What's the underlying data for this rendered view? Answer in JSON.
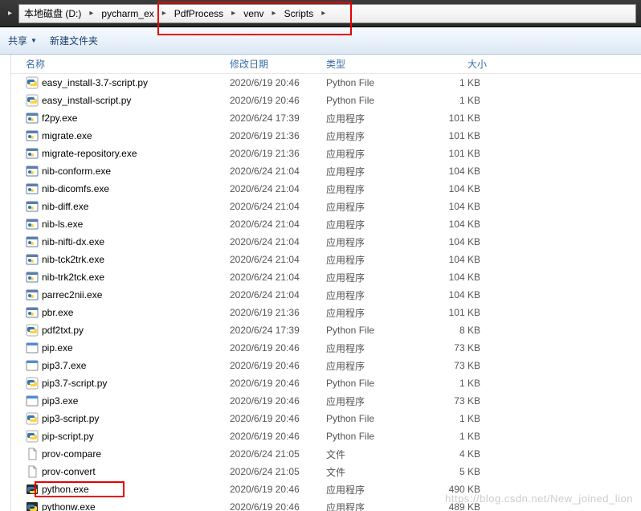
{
  "breadcrumb": {
    "items": [
      {
        "label": "本地磁盘 (D:)"
      },
      {
        "label": "pycharm_ex"
      },
      {
        "label": "PdfProcess"
      },
      {
        "label": "venv"
      },
      {
        "label": "Scripts"
      }
    ]
  },
  "toolbar": {
    "share": "共享",
    "new_folder": "新建文件夹"
  },
  "columns": {
    "name": "名称",
    "date": "修改日期",
    "type": "类型",
    "size": "大小"
  },
  "files": [
    {
      "icon": "python",
      "name": "easy_install-3.7-script.py",
      "date": "2020/6/19 20:46",
      "type": "Python File",
      "size": "1 KB"
    },
    {
      "icon": "python",
      "name": "easy_install-script.py",
      "date": "2020/6/19 20:46",
      "type": "Python File",
      "size": "1 KB"
    },
    {
      "icon": "exe",
      "name": "f2py.exe",
      "date": "2020/6/24 17:39",
      "type": "应用程序",
      "size": "101 KB"
    },
    {
      "icon": "exe",
      "name": "migrate.exe",
      "date": "2020/6/19 21:36",
      "type": "应用程序",
      "size": "101 KB"
    },
    {
      "icon": "exe",
      "name": "migrate-repository.exe",
      "date": "2020/6/19 21:36",
      "type": "应用程序",
      "size": "101 KB"
    },
    {
      "icon": "exe",
      "name": "nib-conform.exe",
      "date": "2020/6/24 21:04",
      "type": "应用程序",
      "size": "104 KB"
    },
    {
      "icon": "exe",
      "name": "nib-dicomfs.exe",
      "date": "2020/6/24 21:04",
      "type": "应用程序",
      "size": "104 KB"
    },
    {
      "icon": "exe",
      "name": "nib-diff.exe",
      "date": "2020/6/24 21:04",
      "type": "应用程序",
      "size": "104 KB"
    },
    {
      "icon": "exe",
      "name": "nib-ls.exe",
      "date": "2020/6/24 21:04",
      "type": "应用程序",
      "size": "104 KB"
    },
    {
      "icon": "exe",
      "name": "nib-nifti-dx.exe",
      "date": "2020/6/24 21:04",
      "type": "应用程序",
      "size": "104 KB"
    },
    {
      "icon": "exe",
      "name": "nib-tck2trk.exe",
      "date": "2020/6/24 21:04",
      "type": "应用程序",
      "size": "104 KB"
    },
    {
      "icon": "exe",
      "name": "nib-trk2tck.exe",
      "date": "2020/6/24 21:04",
      "type": "应用程序",
      "size": "104 KB"
    },
    {
      "icon": "exe",
      "name": "parrec2nii.exe",
      "date": "2020/6/24 21:04",
      "type": "应用程序",
      "size": "104 KB"
    },
    {
      "icon": "exe",
      "name": "pbr.exe",
      "date": "2020/6/19 21:36",
      "type": "应用程序",
      "size": "101 KB"
    },
    {
      "icon": "python",
      "name": "pdf2txt.py",
      "date": "2020/6/24 17:39",
      "type": "Python File",
      "size": "8 KB"
    },
    {
      "icon": "window",
      "name": "pip.exe",
      "date": "2020/6/19 20:46",
      "type": "应用程序",
      "size": "73 KB"
    },
    {
      "icon": "window",
      "name": "pip3.7.exe",
      "date": "2020/6/19 20:46",
      "type": "应用程序",
      "size": "73 KB"
    },
    {
      "icon": "python",
      "name": "pip3.7-script.py",
      "date": "2020/6/19 20:46",
      "type": "Python File",
      "size": "1 KB"
    },
    {
      "icon": "window",
      "name": "pip3.exe",
      "date": "2020/6/19 20:46",
      "type": "应用程序",
      "size": "73 KB"
    },
    {
      "icon": "python",
      "name": "pip3-script.py",
      "date": "2020/6/19 20:46",
      "type": "Python File",
      "size": "1 KB"
    },
    {
      "icon": "python",
      "name": "pip-script.py",
      "date": "2020/6/19 20:46",
      "type": "Python File",
      "size": "1 KB"
    },
    {
      "icon": "file",
      "name": "prov-compare",
      "date": "2020/6/24 21:05",
      "type": "文件",
      "size": "4 KB"
    },
    {
      "icon": "file",
      "name": "prov-convert",
      "date": "2020/6/24 21:05",
      "type": "文件",
      "size": "5 KB"
    },
    {
      "icon": "pyexe",
      "name": "python.exe",
      "date": "2020/6/19 20:46",
      "type": "应用程序",
      "size": "490 KB",
      "highlight": true
    },
    {
      "icon": "pyexe",
      "name": "pythonw.exe",
      "date": "2020/6/19 20:46",
      "type": "应用程序",
      "size": "489 KB"
    }
  ],
  "watermark": "https://blog.csdn.net/New_joined_lion"
}
